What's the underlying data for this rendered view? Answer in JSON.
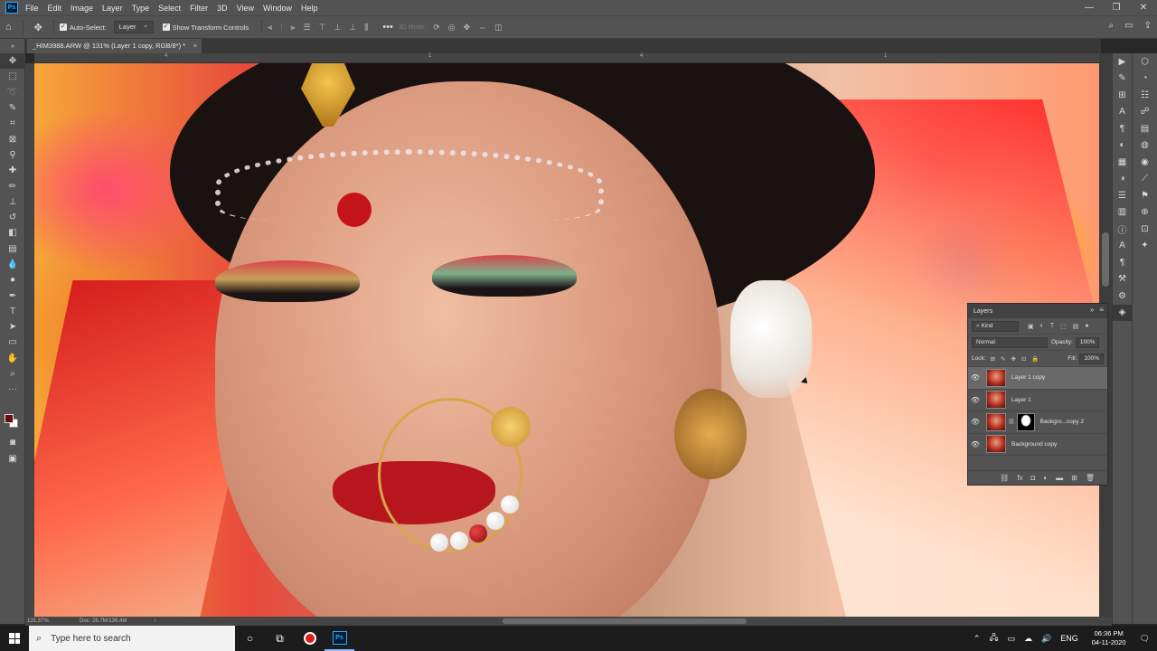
{
  "app": {
    "logo_text": "Ps"
  },
  "menu": [
    "File",
    "Edit",
    "Image",
    "Layer",
    "Type",
    "Select",
    "Filter",
    "3D",
    "View",
    "Window",
    "Help"
  ],
  "window_controls": {
    "minimize": "—",
    "maximize": "❐",
    "close": "✕"
  },
  "options": {
    "auto_select_label": "Auto-Select:",
    "auto_select_target": "Layer",
    "show_transform_label": "Show Transform Controls",
    "more": "•••",
    "mode_3d": "3D Mode:"
  },
  "document_tab": {
    "title": "_HIM3988.ARW @ 131% (Layer 1 copy, RGB/8*) *",
    "close": "×"
  },
  "ruler": {
    "marks": [
      "4",
      "1",
      "4",
      "1"
    ]
  },
  "layers_panel": {
    "title": "Layers",
    "filter_kind": "Kind",
    "blend_mode": "Normal",
    "opacity_label": "Opacity:",
    "opacity_value": "100%",
    "lock_label": "Lock:",
    "fill_label": "Fill:",
    "fill_value": "100%",
    "layers": [
      {
        "name": "Layer 1 copy",
        "selected": true,
        "has_mask": false
      },
      {
        "name": "Layer 1",
        "selected": false,
        "has_mask": false
      },
      {
        "name": "Backgro...copy 2",
        "selected": false,
        "has_mask": true
      },
      {
        "name": "Background copy",
        "selected": false,
        "has_mask": false
      }
    ]
  },
  "status": {
    "zoom": "131.37%",
    "doc_size": "Doc: 26.7M/136.4M"
  },
  "taskbar": {
    "search_placeholder": "Type here to search",
    "language": "ENG",
    "time": "06:36 PM",
    "date": "04-11-2020"
  }
}
